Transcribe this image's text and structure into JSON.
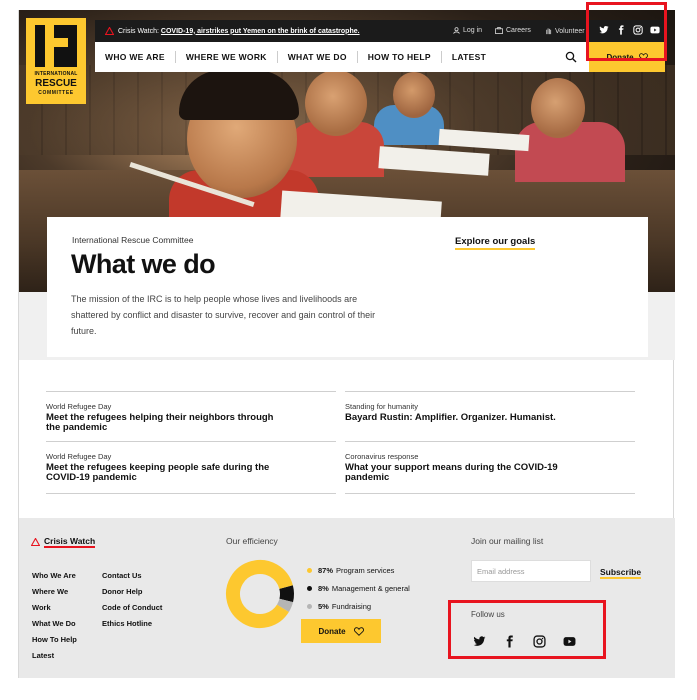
{
  "brand": {
    "line1": "INTERNATIONAL",
    "line2a": "RESCUE",
    "line3": "COMMITTEE",
    "accent": "#fdc82f",
    "alert": "#e8141f"
  },
  "topbar": {
    "crisis_prefix": "Crisis Watch:",
    "crisis_headline": "COVID-19, airstrikes put Yemen on the brink of catastrophe.",
    "login": "Log in",
    "careers": "Careers",
    "volunteer": "Volunteer",
    "social_icons": [
      "twitter-icon",
      "facebook-icon",
      "instagram-icon",
      "youtube-icon"
    ]
  },
  "nav": {
    "items": [
      "WHO WE ARE",
      "WHERE WE WORK",
      "WHAT WE DO",
      "HOW TO HELP",
      "LATEST"
    ],
    "donate": "Donate"
  },
  "card": {
    "eyebrow": "International Rescue Committee",
    "title": "What we do",
    "link": "Explore our goals",
    "description": "The mission of the IRC is to help people whose lives and livelihoods are shattered by conflict and disaster to survive, recover and gain control of their future."
  },
  "news": [
    {
      "eyebrow": "World Refugee Day",
      "headline": "Meet the refugees helping their neighbors through the pandemic"
    },
    {
      "eyebrow": "Standing for humanity",
      "headline": "Bayard Rustin: Amplifier. Organizer. Humanist."
    },
    {
      "eyebrow": "World Refugee Day",
      "headline": "Meet the refugees keeping people safe during the COVID-19 pandemic"
    },
    {
      "eyebrow": "Coronavirus response",
      "headline": "What your support means during the COVID-19 pandemic"
    }
  ],
  "footer": {
    "crisis_watch": "Crisis Watch",
    "links_col1": [
      "Who We Are",
      "Where We Work",
      "What We Do",
      "How To Help",
      "Latest"
    ],
    "links_col2": [
      "Contact Us",
      "Donor Help",
      "Code of Conduct",
      "Ethics Hotline"
    ],
    "efficiency_label": "Our efficiency",
    "efficiency": [
      {
        "pct": "87%",
        "label": "Program services",
        "value": 87,
        "color": "#fdc82f"
      },
      {
        "pct": "8%",
        "label": "Management & general",
        "value": 8,
        "color": "#111111"
      },
      {
        "pct": "5%",
        "label": "Fundraising",
        "value": 5,
        "color": "#b5b5b5"
      }
    ],
    "donate": "Donate",
    "mailing_label": "Join our mailing list",
    "email_placeholder": "Email address",
    "subscribe": "Subscribe",
    "follow_label": "Follow us"
  }
}
